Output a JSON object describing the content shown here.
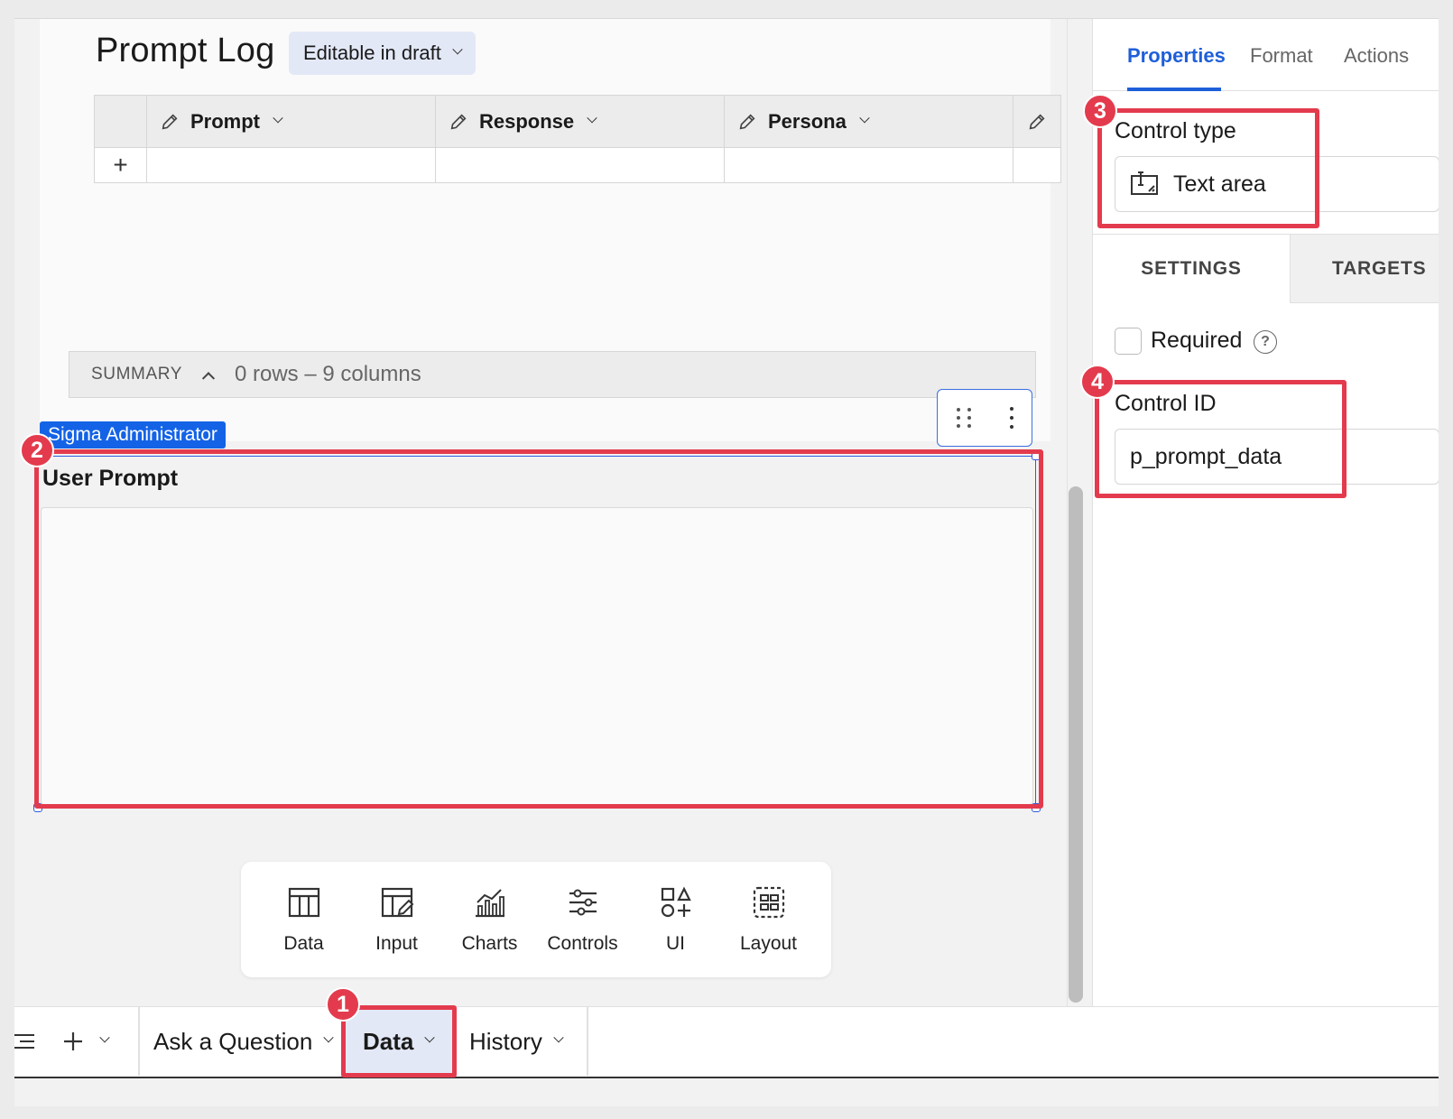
{
  "canvas": {
    "title": "Prompt Log",
    "mode_pill": "Editable in draft",
    "table": {
      "columns": [
        "Prompt",
        "Response",
        "Persona"
      ],
      "add_row": "+"
    },
    "summary": {
      "label": "SUMMARY",
      "info": "0 rows – 9 columns"
    },
    "selected_by_tag": "Sigma Administrator",
    "control": {
      "label": "User Prompt",
      "value": ""
    },
    "element_bar": {
      "items": [
        {
          "label": "Data",
          "icon": "table-icon"
        },
        {
          "label": "Input",
          "icon": "input-table-icon"
        },
        {
          "label": "Charts",
          "icon": "chart-icon"
        },
        {
          "label": "Controls",
          "icon": "sliders-icon"
        },
        {
          "label": "UI",
          "icon": "shapes-icon"
        },
        {
          "label": "Layout",
          "icon": "layout-icon"
        }
      ]
    }
  },
  "panel": {
    "tabs": [
      "Properties",
      "Format",
      "Actions"
    ],
    "active_tab": "Properties",
    "control_type_label": "Control type",
    "control_type_value": "Text area",
    "sections": [
      "SETTINGS",
      "TARGETS"
    ],
    "required_label": "Required",
    "required_checked": false,
    "control_id_label": "Control ID",
    "control_id_value": "p_prompt_data"
  },
  "bottom_tabs": {
    "items": [
      "Ask a Question",
      "Data",
      "History"
    ],
    "active": "Data"
  },
  "annotations": {
    "badges": [
      "1",
      "2",
      "3",
      "4"
    ],
    "color": "#e33b4d"
  },
  "colors": {
    "accent": "#1e5fd9",
    "selection": "#2d5ce0",
    "admin_tag": "#1463e6",
    "active_tab_bg": "#e3e8f6"
  }
}
